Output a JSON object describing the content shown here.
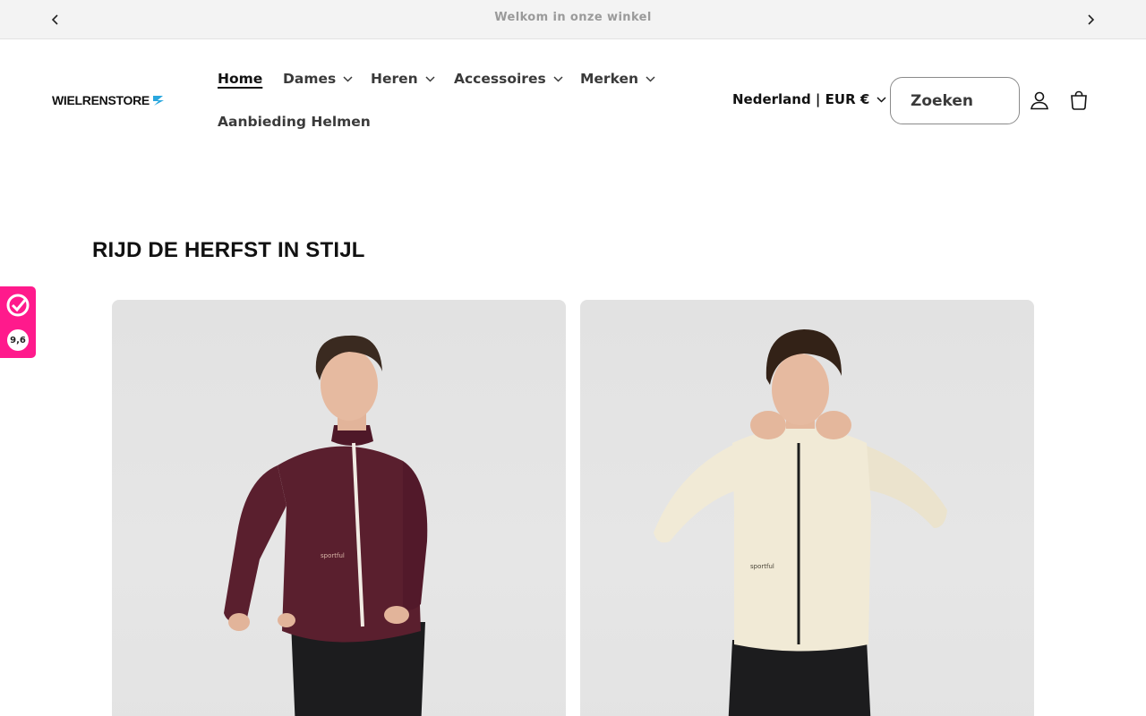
{
  "announcement": {
    "text": "Welkom in onze winkel"
  },
  "header": {
    "logo_text": "WIELRENSTORE",
    "nav": [
      {
        "label": "Home",
        "active": true,
        "dropdown": false
      },
      {
        "label": "Dames",
        "active": false,
        "dropdown": true
      },
      {
        "label": "Heren",
        "active": false,
        "dropdown": true
      },
      {
        "label": "Accessoires",
        "active": false,
        "dropdown": true
      },
      {
        "label": "Merken",
        "active": false,
        "dropdown": true
      },
      {
        "label": "Aanbieding Helmen",
        "active": false,
        "dropdown": false
      }
    ],
    "country_selector": "Nederland | EUR €",
    "search": {
      "placeholder": "Zoeken"
    },
    "icons": {
      "account": "account-icon",
      "cart": "cart-icon"
    }
  },
  "section": {
    "title": "RIJD DE HERFST IN STIJL",
    "products": [
      {
        "jersey_color": "#5a1f2e",
        "zip_color": "#f2ece4",
        "brand_print": "sportful"
      },
      {
        "jersey_color": "#f1ead6",
        "zip_color": "#1d1d1d",
        "brand_print": "sportful"
      }
    ]
  },
  "review_badge": {
    "score": "9,6",
    "color": "#ff1a8c"
  }
}
